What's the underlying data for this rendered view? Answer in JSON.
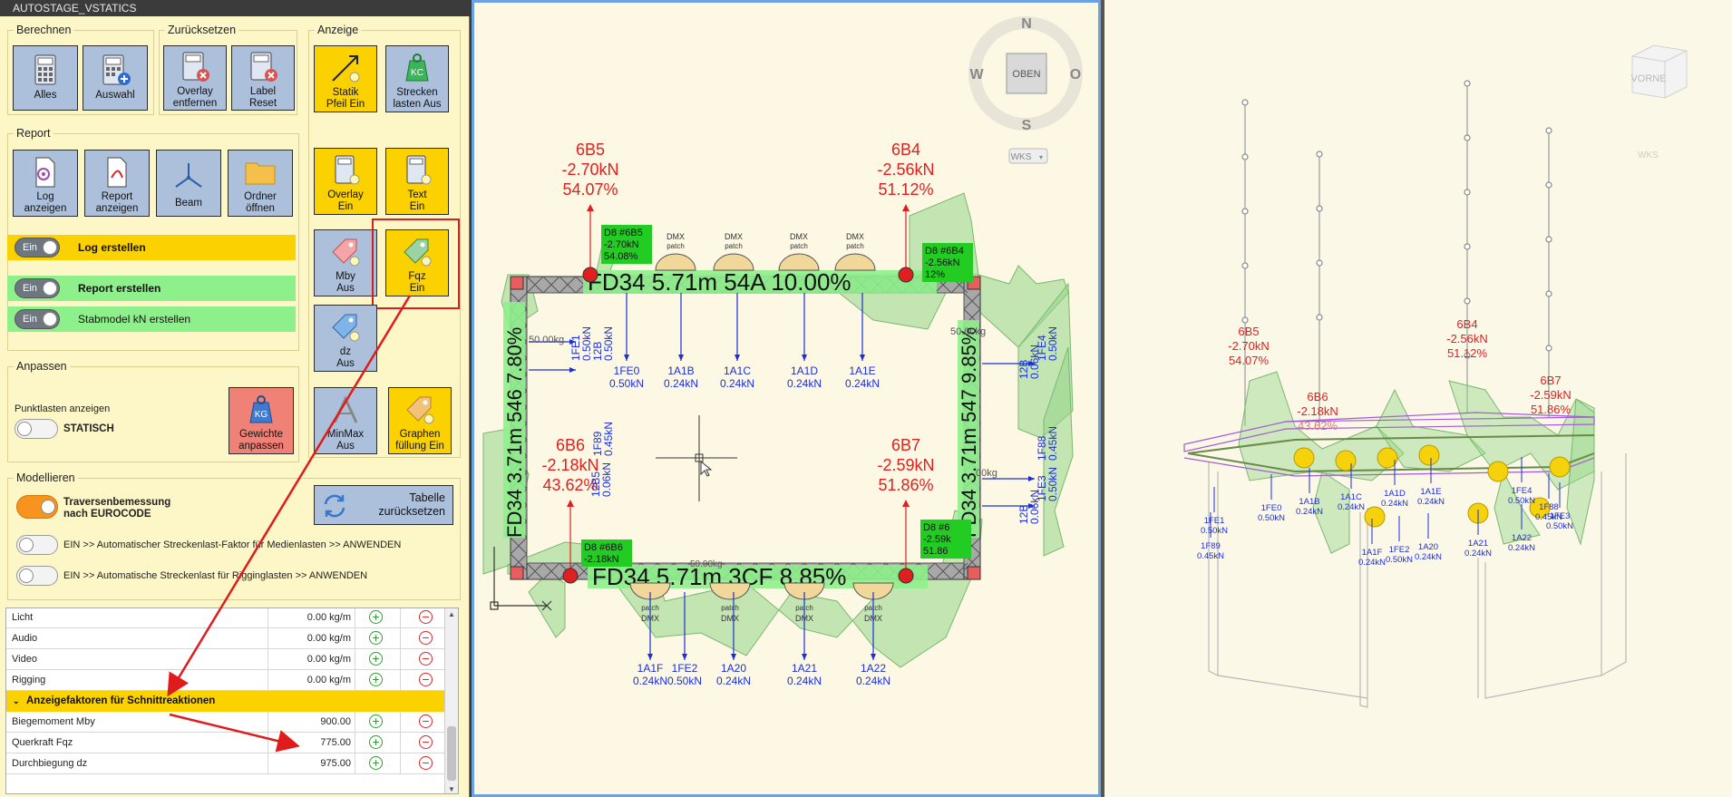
{
  "window": {
    "title": "AUTOSTAGE_VSTATICS"
  },
  "groups": {
    "berechnen": {
      "title": "Berechnen",
      "alles": "Alles",
      "auswahl": "Auswahl"
    },
    "zuruecksetzen": {
      "title": "Zurücksetzen",
      "overlay_l1": "Overlay",
      "overlay_l2": "entfernen",
      "label_l1": "Label",
      "label_l2": "Reset"
    },
    "anzeige": {
      "title": "Anzeige",
      "statik_l1": "Statik",
      "statik_l2": "Pfeil Ein",
      "strecken_l1": "Strecken",
      "strecken_l2": "lasten Aus",
      "overlay_l1": "Overlay",
      "overlay_l2": "Ein",
      "text_l1": "Text",
      "text_l2": "Ein",
      "mby_l1": "Mby",
      "mby_l2": "Aus",
      "fqz_l1": "Fqz",
      "fqz_l2": "Ein",
      "dz_l1": "dz",
      "dz_l2": "Aus",
      "minmax_l1": "MinMax",
      "minmax_l2": "Aus",
      "graphen_l1": "Graphen",
      "graphen_l2": "füllung Ein",
      "tabelle_l1": "Tabelle",
      "tabelle_l2": "zurücksetzen"
    },
    "report": {
      "title": "Report",
      "log_l1": "Log",
      "log_l2": "anzeigen",
      "report_l1": "Report",
      "report_l2": "anzeigen",
      "beam": "Beam",
      "ordner_l1": "Ordner",
      "ordner_l2": "öffnen",
      "toggle_text": "Ein",
      "log_erstellen": "Log erstellen",
      "report_erstellen": "Report erstellen",
      "stabmodel": "Stabmodel kN erstellen"
    },
    "anpassen": {
      "title": "Anpassen",
      "punktlasten": "Punktlasten anzeigen",
      "statisch": "STATISCH",
      "gewichte_l1": "Gewichte",
      "gewichte_l2": "anpassen"
    },
    "modellieren": {
      "title": "Modellieren",
      "trav_l1": "Traversenbemessung",
      "trav_l2": "nach EUROCODE",
      "auto1": "EIN >> Automatischer Streckenlast-Faktor für Medienlasten >> ANWENDEN",
      "auto2": "EIN >> Automatische Streckenlast für Rigginglasten >> ANWENDEN"
    }
  },
  "table": {
    "rows": [
      {
        "name": "Licht",
        "value": "0.00 kg/m"
      },
      {
        "name": "Audio",
        "value": "0.00 kg/m"
      },
      {
        "name": "Video",
        "value": "0.00 kg/m"
      },
      {
        "name": "Rigging",
        "value": "0.00 kg/m"
      }
    ],
    "section": "Anzeigefaktoren für Schnittreaktionen",
    "factor_rows": [
      {
        "name": "Biegemoment Mby",
        "value": "900.00"
      },
      {
        "name": "Querkraft Fqz",
        "value": "775.00"
      },
      {
        "name": "Durchbiegung dz",
        "value": "975.00"
      }
    ]
  },
  "viewport_top": {
    "compass": {
      "n": "N",
      "s": "S",
      "w": "W",
      "o": "O",
      "center": "OBEN",
      "wks": "WKS"
    },
    "beam_top": "FD34  5.71m  54A  10.00%",
    "beam_bottom": "FD34  5.71m  3CF  8.85%",
    "beam_left": "FD34  3.71m  546  7.80%",
    "beam_right": "FD34  3.71m  547  9.85%",
    "supports": [
      {
        "id": "6B5",
        "force": "-2.70kN",
        "pct": "54.07%"
      },
      {
        "id": "6B4",
        "force": "-2.56kN",
        "pct": "51.12%"
      },
      {
        "id": "6B6",
        "force": "-2.18kN",
        "pct": "43.62%"
      },
      {
        "id": "6B7",
        "force": "-2.59kN",
        "pct": "51.86%"
      }
    ],
    "green_tags": [
      {
        "l1": "D8  #6B5",
        "l2": "-2.70kN",
        "l3": "54.08%"
      },
      {
        "l1": "D8  #6B4",
        "l2": "-2.56kN",
        "l3": "12%"
      },
      {
        "l1": "D8  #6B6",
        "l2": "-2.18kN"
      },
      {
        "l1": "D8  #6",
        "l2": "-2.59k",
        "l3": "51.86"
      }
    ],
    "top_loads": [
      {
        "id": "1FE0",
        "val": "0.50kN"
      },
      {
        "id": "1A1B",
        "val": "0.24kN"
      },
      {
        "id": "1A1C",
        "val": "0.24kN"
      },
      {
        "id": "1A1D",
        "val": "0.24kN"
      },
      {
        "id": "1A1E",
        "val": "0.24kN"
      }
    ],
    "bottom_loads": [
      {
        "id": "1A1F",
        "val": "0.24kN"
      },
      {
        "id": "1FE2",
        "val": "0.50kN"
      },
      {
        "id": "1A20",
        "val": "0.24kN"
      },
      {
        "id": "1A21",
        "val": "0.24kN"
      },
      {
        "id": "1A22",
        "val": "0.24kN"
      }
    ],
    "side_loads": [
      {
        "id": "1FE1",
        "val": "0.50kN"
      },
      {
        "id": "12B",
        "val": "0.50kN"
      },
      {
        "id": "1F89",
        "val": "0.45kN"
      },
      {
        "id": "12B5",
        "val": "0.06kN"
      },
      {
        "id": "1FE4",
        "val": "0.50kN"
      },
      {
        "id": "12B",
        "val": "0.06kN"
      },
      {
        "id": "1F88",
        "val": "0.45kN"
      },
      {
        "id": "1FE3",
        "val": "0.50kN"
      },
      {
        "id": "12B",
        "val": "0.06kN"
      }
    ],
    "dmx": "DMX",
    "patch": "patch",
    "kg_left": "50.00kg",
    "kg_right1": "50.00kg",
    "kg_right2": ".00kg",
    "kg_bottom": "50.00kg"
  },
  "viewport_3d": {
    "viewcube": "VORNE",
    "wks": "WKS",
    "supports": [
      {
        "id": "6B5",
        "force": "-2.70kN",
        "pct": "54.07%"
      },
      {
        "id": "6B6",
        "force": "-2.18kN",
        "pct": "43.62%"
      },
      {
        "id": "6B4",
        "force": "-2.56kN",
        "pct": "51.12%"
      },
      {
        "id": "6B7",
        "force": "-2.59kN",
        "pct": "51.86%"
      }
    ],
    "loads": [
      {
        "id": "1FE1",
        "val": "0.50kN"
      },
      {
        "id": "1F89",
        "val": "0.45kN"
      },
      {
        "id": "1FE0",
        "val": "0.50kN"
      },
      {
        "id": "1A1B",
        "val": "0.24kN"
      },
      {
        "id": "1A1C",
        "val": "0.24kN"
      },
      {
        "id": "1A1D",
        "val": "0.24kN"
      },
      {
        "id": "1A1E",
        "val": "0.24kN"
      },
      {
        "id": "1A1F",
        "val": "0.24kN"
      },
      {
        "id": "1FE2",
        "val": "0.50kN"
      },
      {
        "id": "1A20",
        "val": "0.24kN"
      },
      {
        "id": "1A21",
        "val": "0.24kN"
      },
      {
        "id": "1A22",
        "val": "0.24kN"
      },
      {
        "id": "1FE4",
        "val": "0.50kN"
      },
      {
        "id": "1F88",
        "val": "0.45kN"
      },
      {
        "id": "1FE3",
        "val": "0.50kN"
      }
    ]
  }
}
